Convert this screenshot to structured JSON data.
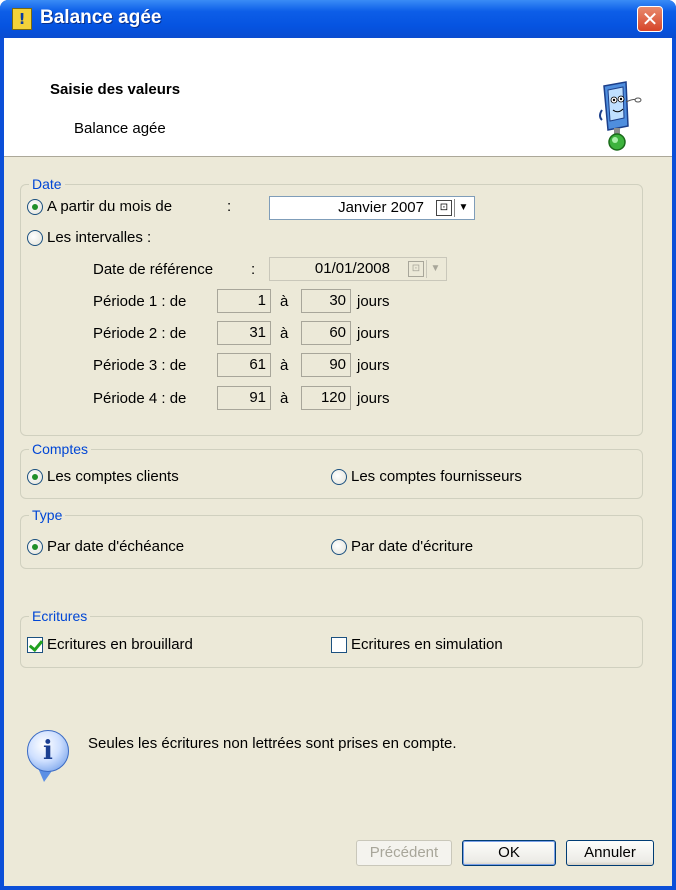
{
  "window": {
    "title": "Balance agée",
    "close_glyph": "✕",
    "title_icon": "!"
  },
  "header": {
    "title": "Saisie des valeurs",
    "subtitle": "Balance agée"
  },
  "date_group": {
    "legend": "Date",
    "option_month": {
      "label": "A partir du mois de",
      "colon": ":",
      "selected": true
    },
    "month_value": "Janvier 2007",
    "option_intervals": {
      "label": "Les intervalles :",
      "selected": false
    },
    "ref_label": "Date de référence",
    "ref_colon": ":",
    "ref_value": "01/01/2008",
    "a_label": "à",
    "jours_label": "jours",
    "periods": [
      {
        "label": "Période 1 : de",
        "from": "1",
        "to": "30"
      },
      {
        "label": "Période 2 : de",
        "from": "31",
        "to": "60"
      },
      {
        "label": "Période 3 : de",
        "from": "61",
        "to": "90"
      },
      {
        "label": "Période 4 : de",
        "from": "91",
        "to": "120"
      }
    ]
  },
  "comptes_group": {
    "legend": "Comptes",
    "option_clients": {
      "label": "Les comptes clients",
      "selected": true
    },
    "option_fournisseurs": {
      "label": "Les comptes fournisseurs",
      "selected": false
    }
  },
  "type_group": {
    "legend": "Type",
    "option_echeance": {
      "label": "Par date d'échéance",
      "selected": true
    },
    "option_ecriture": {
      "label": "Par date d'écriture",
      "selected": false
    }
  },
  "ecritures_group": {
    "legend": "Ecritures",
    "check_brouillard": {
      "label": "Ecritures en brouillard",
      "checked": true
    },
    "check_simulation": {
      "label": "Ecritures en simulation",
      "checked": false
    }
  },
  "info": {
    "message": "Seules les écritures non lettrées sont prises en compte.",
    "icon": "info-icon"
  },
  "buttons": {
    "previous": "Précédent",
    "ok": "OK",
    "cancel": "Annuler"
  },
  "icons": {
    "calendar": "calendar-icon",
    "dropdown": "chevron-down-icon",
    "info_glyph": "i",
    "arrow_glyph": "▼",
    "calendar_glyph": "⊡"
  },
  "colors": {
    "titlebar": "#0553e0",
    "legend": "#0046d5",
    "dialog_bg": "#ece9d8",
    "radio_dot": "#1f8f28"
  }
}
